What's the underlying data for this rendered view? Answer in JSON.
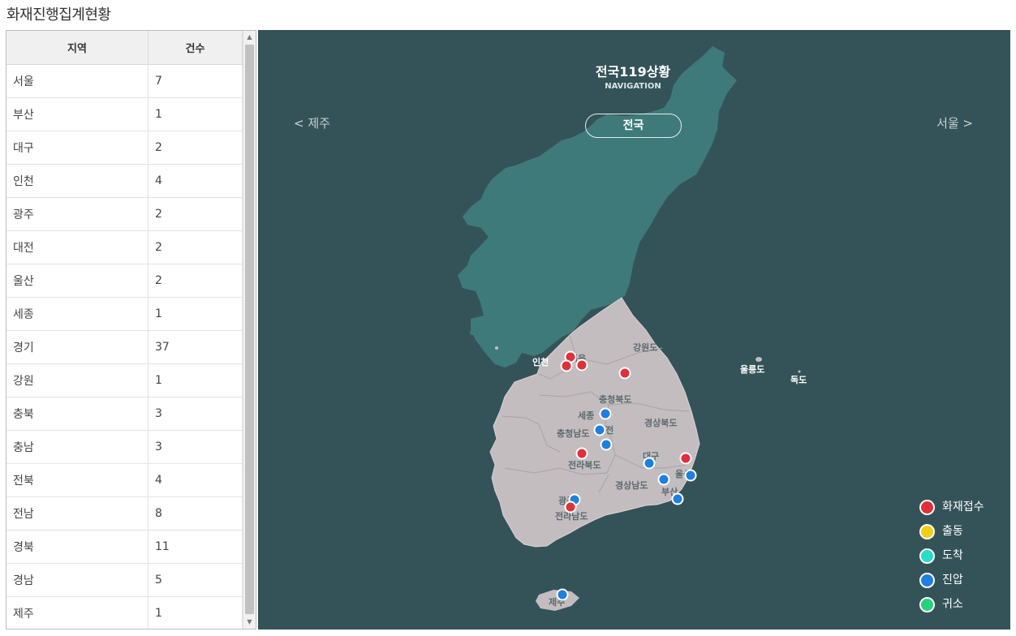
{
  "page_title": "화재진행집계현황",
  "table": {
    "headers": [
      "지역",
      "건수"
    ],
    "rows": [
      [
        "서울",
        "7"
      ],
      [
        "부산",
        "1"
      ],
      [
        "대구",
        "2"
      ],
      [
        "인천",
        "4"
      ],
      [
        "광주",
        "2"
      ],
      [
        "대전",
        "2"
      ],
      [
        "울산",
        "2"
      ],
      [
        "세종",
        "1"
      ],
      [
        "경기",
        "37"
      ],
      [
        "강원",
        "1"
      ],
      [
        "충북",
        "3"
      ],
      [
        "충남",
        "3"
      ],
      [
        "전북",
        "4"
      ],
      [
        "전남",
        "8"
      ],
      [
        "경북",
        "11"
      ],
      [
        "경남",
        "5"
      ],
      [
        "제주",
        "1"
      ]
    ]
  },
  "map": {
    "title": "전국119상황",
    "subtitle": "NAVIGATION",
    "prev": "<  제주",
    "next": "서울  >",
    "current": "전국",
    "region_labels": {
      "incheon": "인천",
      "seoul": "서울",
      "gangwon": "강원도",
      "chungbuk": "충청북도",
      "sejong": "세종",
      "chungnam": "충청남도",
      "daejeon": "대전",
      "gyeongbuk": "경상북도",
      "jeonbuk": "전라북도",
      "daegu": "대구",
      "ulsan": "울산",
      "gyeongnam": "경상남도",
      "busan": "부산",
      "gwangju": "광주",
      "jeonnam": "전라남도",
      "jeju": "제주",
      "ulleungdo": "울릉도",
      "dokdo": "독도"
    },
    "colors": {
      "background": "#345358",
      "north": "#3f7a7b",
      "south": "#c4bdbf",
      "status_colors": {
        "화재접수": "#e0303a",
        "출동": "#f2cf15",
        "도착": "#27dcc8",
        "진압": "#1e7fe0",
        "귀소": "#28d27a"
      }
    },
    "legend": [
      {
        "label": "화재접수",
        "color": "#e0303a"
      },
      {
        "label": "출동",
        "color": "#f2cf15"
      },
      {
        "label": "도착",
        "color": "#27dcc8"
      },
      {
        "label": "진압",
        "color": "#1e7fe0"
      },
      {
        "label": "귀소",
        "color": "#28d27a"
      }
    ]
  }
}
